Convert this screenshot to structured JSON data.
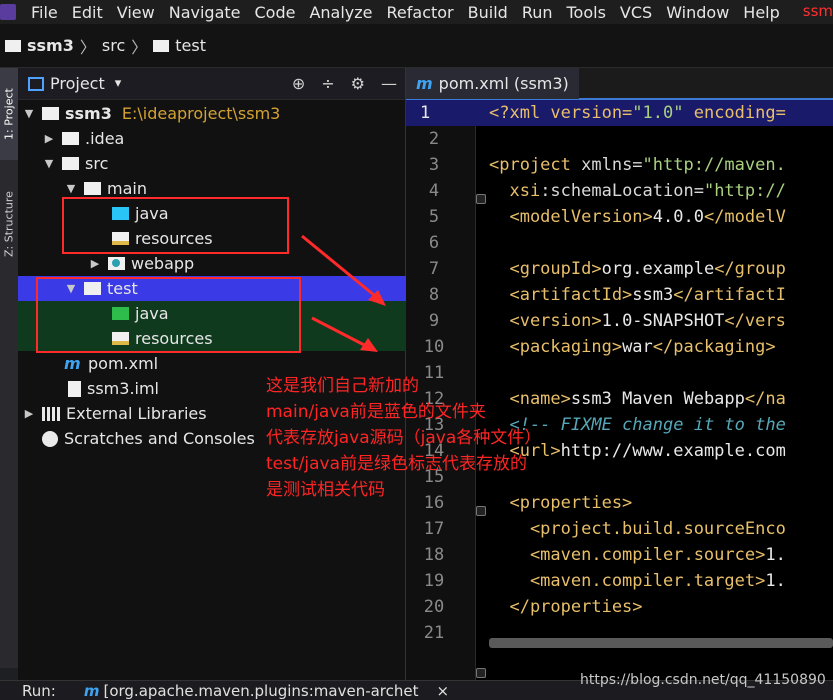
{
  "menubar": {
    "items": [
      "File",
      "Edit",
      "View",
      "Navigate",
      "Code",
      "Analyze",
      "Refactor",
      "Build",
      "Run",
      "Tools",
      "VCS",
      "Window",
      "Help"
    ],
    "title_tail": "ssm"
  },
  "breadcrumb": {
    "items": [
      "ssm3",
      "src",
      "test"
    ]
  },
  "vstrip": {
    "project_tab": "1: Project",
    "structure_tab": "Z: Structure"
  },
  "project_panel": {
    "title": "Project",
    "dropdown_glyph": "▾",
    "tools": [
      "⊕",
      "÷",
      "⚙",
      "—"
    ],
    "tree": {
      "root_name": "ssm3",
      "root_path": "E:\\ideaproject\\ssm3",
      "idea": ".idea",
      "src": "src",
      "main": "main",
      "main_java": "java",
      "main_resources": "resources",
      "webapp": "webapp",
      "test": "test",
      "test_java": "java",
      "test_resources": "resources",
      "pom": "pom.xml",
      "iml": "ssm3.iml",
      "external_libraries": "External Libraries",
      "scratches": "Scratches and Consoles"
    }
  },
  "annotation": {
    "lines": [
      "这是我们自己新加的",
      "main/java前是蓝色的文件夹",
      "代表存放java源码（java各种文件）",
      "test/java前是绿色标志代表存放的",
      "是测试相关代码"
    ]
  },
  "editor": {
    "tab_label": "pom.xml (ssm3)",
    "line_numbers": [
      "1",
      "2",
      "3",
      "4",
      "5",
      "6",
      "7",
      "8",
      "9",
      "10",
      "11",
      "12",
      "13",
      "14",
      "15",
      "16",
      "17",
      "18",
      "19",
      "20",
      "21"
    ],
    "code": {
      "l1a": "<?xml version=",
      "l1b": "\"1.0\"",
      "l1c": " encoding=",
      "l3a": "<project ",
      "l3b": "xmlns=",
      "l3c": "\"http://maven.",
      "l4a": "  xsi",
      "l4b": ":schemaLocation=",
      "l4c": "\"http://",
      "l5a": "  <modelVersion>",
      "l5b": "4.0.0",
      "l5c": "</modelV",
      "l7a": "  <groupId>",
      "l7b": "org.example",
      "l7c": "</group",
      "l8a": "  <artifactId>",
      "l8b": "ssm3",
      "l8c": "</artifactI",
      "l9a": "  <version>",
      "l9b": "1.0-SNAPSHOT",
      "l9c": "</vers",
      "l10a": "  <packaging>",
      "l10b": "war",
      "l10c": "</packaging>",
      "l12a": "  <name>",
      "l12b": "ssm3 Maven Webapp",
      "l12c": "</na",
      "l13a": "  <!-- ",
      "l13b": "FIXME change it to the",
      "l14a": "  <url>",
      "l14b": "http://www.example.com",
      "l16a": "  <properties>",
      "l17a": "    <project.build.sourceEnco",
      "l18a": "    <maven.compiler.source>",
      "l18b": "1.",
      "l19a": "    <maven.compiler.target>",
      "l19b": "1.",
      "l20a": "  </properties>"
    }
  },
  "runbar": {
    "label": "Run:",
    "task": "[org.apache.maven.plugins:maven-archet",
    "close": "×"
  },
  "watermark": "https://blog.csdn.net/qq_41150890"
}
